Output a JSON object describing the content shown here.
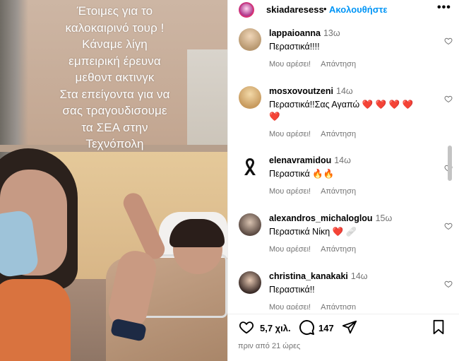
{
  "post": {
    "overlay_lines": [
      "Έτοιμες για το",
      "καλοκαιρινό τουρ !",
      "Κάναμε λίγη",
      "εμπειρική έρευνα",
      "μεθοντ ακτινγκ",
      "Στα επείγοντα για να",
      "σας τραγουδισουμε",
      "τα ΣΕΑ στην",
      "Τεχνόπολη"
    ]
  },
  "header": {
    "username": "skiadaresess",
    "separator": "•",
    "follow_label": "Ακολουθήστε",
    "more_label": "•••"
  },
  "comments": [
    {
      "username": "lappaioanna",
      "time": "13ω",
      "text": "Περαστικά!!!!",
      "like_label": "Μου αρέσει!",
      "reply_label": "Απάντηση"
    },
    {
      "username": "mosxovoutzeni",
      "time": "14ω",
      "text": "Περαστικά!!Σας Αγαπώ ❤️ ❤️ ❤️ ❤️",
      "text2": "❤️",
      "like_label": "Μου αρέσει!",
      "reply_label": "Απάντηση"
    },
    {
      "username": "elenavramidou",
      "time": "14ω",
      "text": "Περαστικά 🔥🔥",
      "like_label": "Μου αρέσει!",
      "reply_label": "Απάντηση"
    },
    {
      "username": "alexandros_michaloglou",
      "time": "15ω",
      "text": "Περαστικά Νίκη ❤️ 🩹",
      "like_label": "Μου αρέσει!",
      "reply_label": "Απάντηση"
    },
    {
      "username": "christina_kanakaki",
      "time": "14ω",
      "text": "Περαστικά!!",
      "like_label": "Μου αρέσει!",
      "reply_label": "Απάντηση"
    }
  ],
  "actions": {
    "likes": "5,7 χιλ.",
    "comments": "147",
    "posted": "πριν από 21 ώρες"
  },
  "colors": {
    "accent": "#0095f6",
    "heart": "#e0202b",
    "muted": "#737373"
  }
}
